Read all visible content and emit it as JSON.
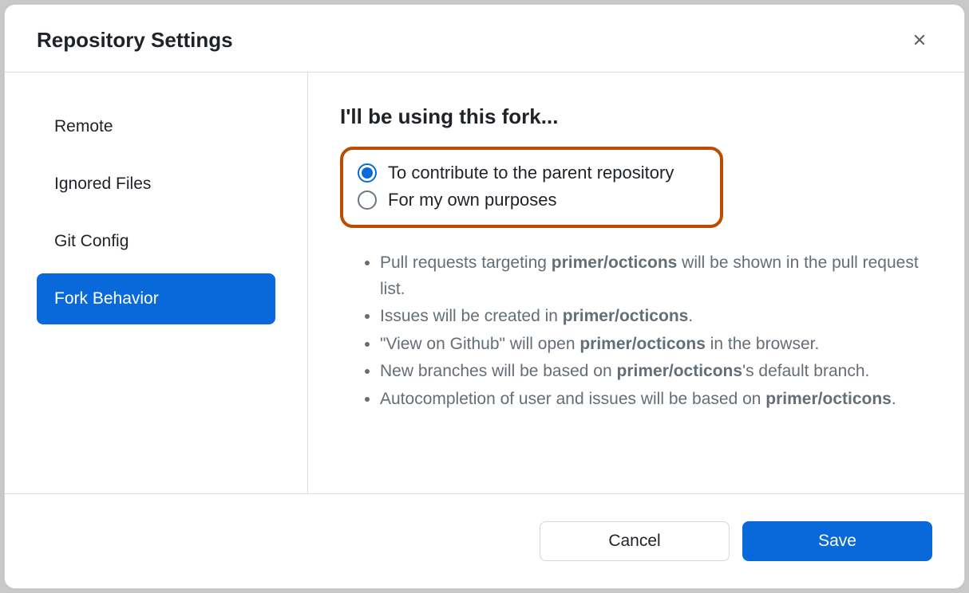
{
  "dialog": {
    "title": "Repository Settings",
    "close_label": "Close"
  },
  "sidebar": {
    "items": [
      {
        "label": "Remote",
        "active": false
      },
      {
        "label": "Ignored Files",
        "active": false
      },
      {
        "label": "Git Config",
        "active": false
      },
      {
        "label": "Fork Behavior",
        "active": true
      }
    ]
  },
  "content": {
    "heading": "I'll be using this fork...",
    "options": [
      {
        "label": "To contribute to the parent repository",
        "checked": true
      },
      {
        "label": "For my own purposes",
        "checked": false
      }
    ],
    "repo": "primer/octicons",
    "bullets": [
      {
        "pre": "Pull requests targeting ",
        "bold": "primer/octicons",
        "post": " will be shown in the pull request list."
      },
      {
        "pre": "Issues will be created in ",
        "bold": "primer/octicons",
        "post": "."
      },
      {
        "pre": "\"View on Github\" will open ",
        "bold": "primer/octicons",
        "post": " in the browser."
      },
      {
        "pre": "New branches will be based on ",
        "bold": "primer/octicons",
        "post": "'s default branch."
      },
      {
        "pre": "Autocompletion of user and issues will be based on ",
        "bold": "primer/octicons",
        "post": "."
      }
    ]
  },
  "footer": {
    "cancel": "Cancel",
    "save": "Save"
  }
}
